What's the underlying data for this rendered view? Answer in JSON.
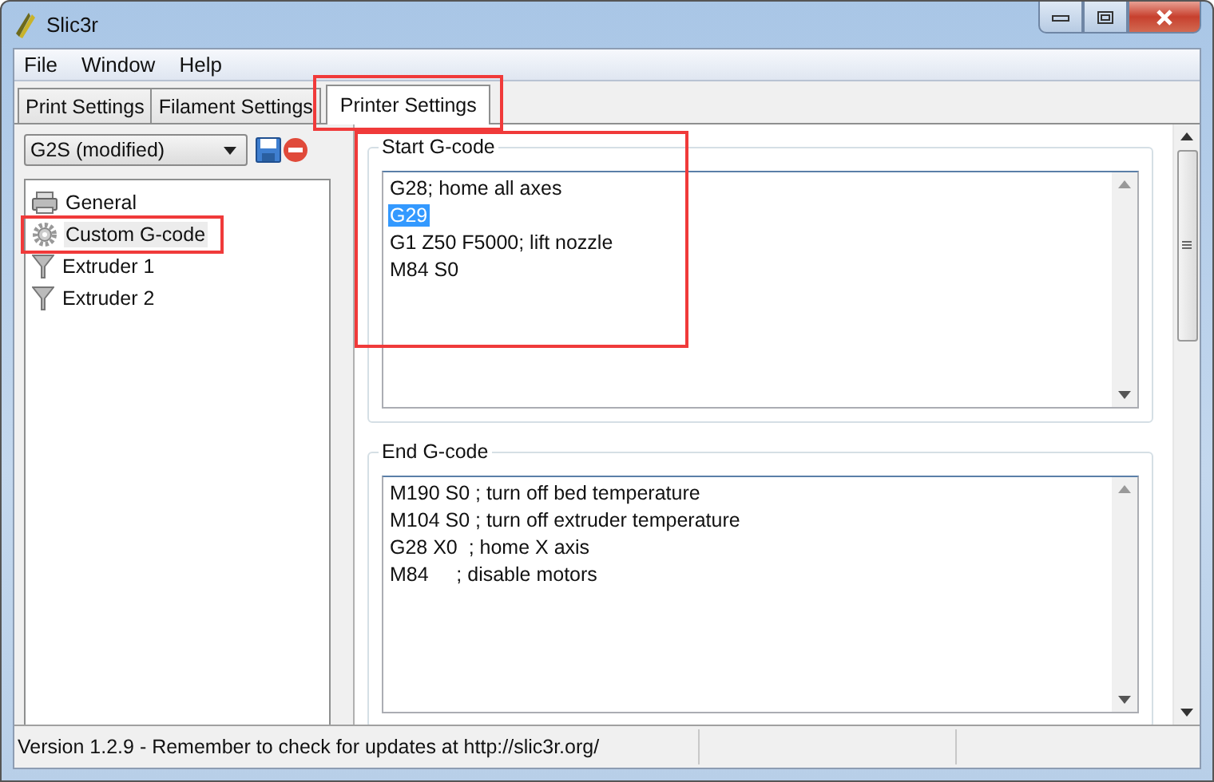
{
  "window": {
    "title": "Slic3r"
  },
  "menu": [
    "File",
    "Window",
    "Help"
  ],
  "tabs": [
    {
      "label": "Print Settings",
      "selected": false,
      "highlighted": false
    },
    {
      "label": "Filament Settings",
      "selected": false,
      "highlighted": false
    },
    {
      "label": "Printer Settings",
      "selected": true,
      "highlighted": true
    }
  ],
  "preset": {
    "value": "G2S (modified)"
  },
  "sidebar": {
    "items": [
      {
        "label": "General",
        "kind": "printer",
        "selected": false,
        "highlighted": false
      },
      {
        "label": "Custom G-code",
        "kind": "gear",
        "selected": true,
        "highlighted": true
      },
      {
        "label": "Extruder 1",
        "kind": "funnel",
        "selected": false,
        "highlighted": false
      },
      {
        "label": "Extruder 2",
        "kind": "funnel",
        "selected": false,
        "highlighted": false
      }
    ]
  },
  "start_gcode": {
    "title": "Start G-code",
    "highlighted": true,
    "lines": [
      {
        "text": "G28; home all axes",
        "selected": false
      },
      {
        "text": "G29",
        "selected": true
      },
      {
        "text": "G1 Z50 F5000; lift nozzle",
        "selected": false
      },
      {
        "text": "M84 S0",
        "selected": false
      }
    ]
  },
  "end_gcode": {
    "title": "End G-code",
    "highlighted": false,
    "lines": [
      {
        "text": "M190 S0 ; turn off bed temperature",
        "selected": false
      },
      {
        "text": "M104 S0 ; turn off extruder temperature",
        "selected": false
      },
      {
        "text": "G28 X0  ; home X axis",
        "selected": false
      },
      {
        "text": "M84     ; disable motors",
        "selected": false
      }
    ]
  },
  "status_bar": {
    "text": "Version 1.2.9 - Remember to check for updates at http://slic3r.org/"
  }
}
